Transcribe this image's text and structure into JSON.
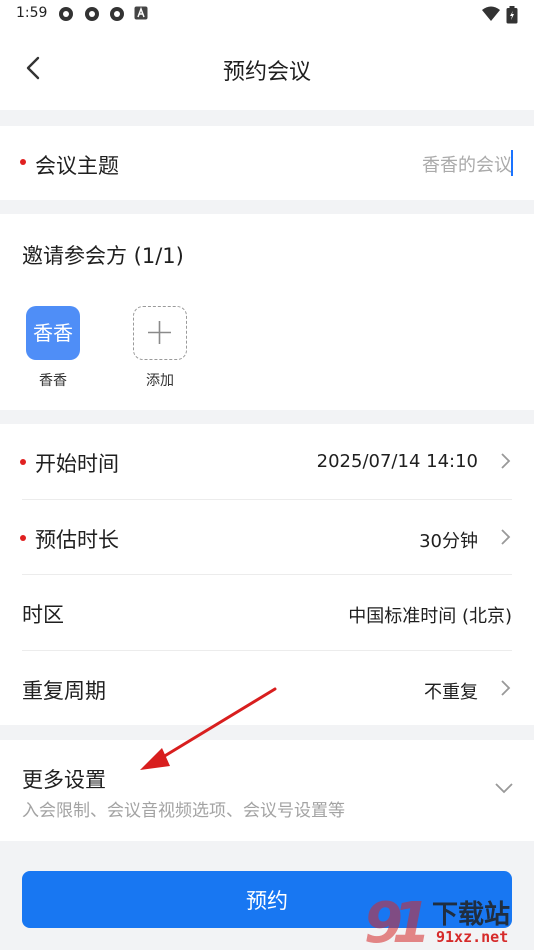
{
  "status_bar": {
    "time": "1:59",
    "notification_icons": [
      "app-icon",
      "app-icon",
      "app-icon",
      "a-letter-icon"
    ],
    "right_icons": [
      "wifi-icon",
      "battery-icon"
    ]
  },
  "nav": {
    "title": "预约会议",
    "back_icon": "chevron-left-icon"
  },
  "subject": {
    "label": "会议主题",
    "placeholder": "香香的会议",
    "required": true
  },
  "invite": {
    "title": "邀请参会方 (1/1)",
    "participants": [
      {
        "avatar_text": "香香",
        "name": "香香"
      }
    ],
    "add_label": "添加"
  },
  "schedule": {
    "rows": [
      {
        "label": "开始时间",
        "value": "2025/07/14 14:10",
        "required": true,
        "arrow": true
      },
      {
        "label": "预估时长",
        "value": "30分钟",
        "required": true,
        "arrow": true
      },
      {
        "label": "时区",
        "value": "中国标准时间 (北京)",
        "required": false,
        "arrow": false
      },
      {
        "label": "重复周期",
        "value": "不重复",
        "required": false,
        "arrow": true
      }
    ]
  },
  "more_settings": {
    "title": "更多设置",
    "subtitle": "入会限制、会议音视频选项、会议号设置等",
    "expand_icon": "chevron-down-icon"
  },
  "submit": {
    "label": "预约"
  },
  "watermark": {
    "text_top": "下载站",
    "text_bottom": "91xz.net"
  },
  "colors": {
    "accent": "#1877f2",
    "required_dot": "#e02020",
    "avatar_bg": "#4f8ef7",
    "annotation_arrow": "#d81e1e"
  }
}
